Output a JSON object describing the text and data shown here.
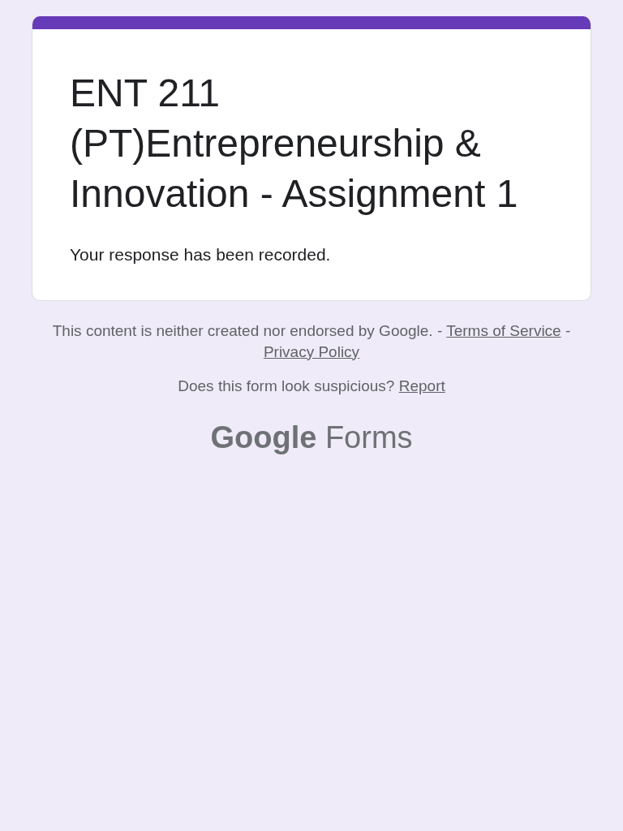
{
  "form": {
    "title": "ENT 211 (PT)Entrepreneurship & Innovation - Assignment 1",
    "message": "Your response has been recorded."
  },
  "footer": {
    "disclaimer": [
      {
        "kind": "text",
        "text": "This content is neither created nor endorsed by Google. - "
      },
      {
        "kind": "link",
        "text": "Terms of Service"
      },
      {
        "kind": "text",
        "text": " - "
      },
      {
        "kind": "link",
        "text": "Privacy Policy"
      }
    ],
    "report": [
      {
        "kind": "text",
        "text": "Does this form look suspicious? "
      },
      {
        "kind": "link",
        "text": "Report"
      }
    ],
    "logo": {
      "brand": "Google",
      "product": "Forms"
    }
  }
}
